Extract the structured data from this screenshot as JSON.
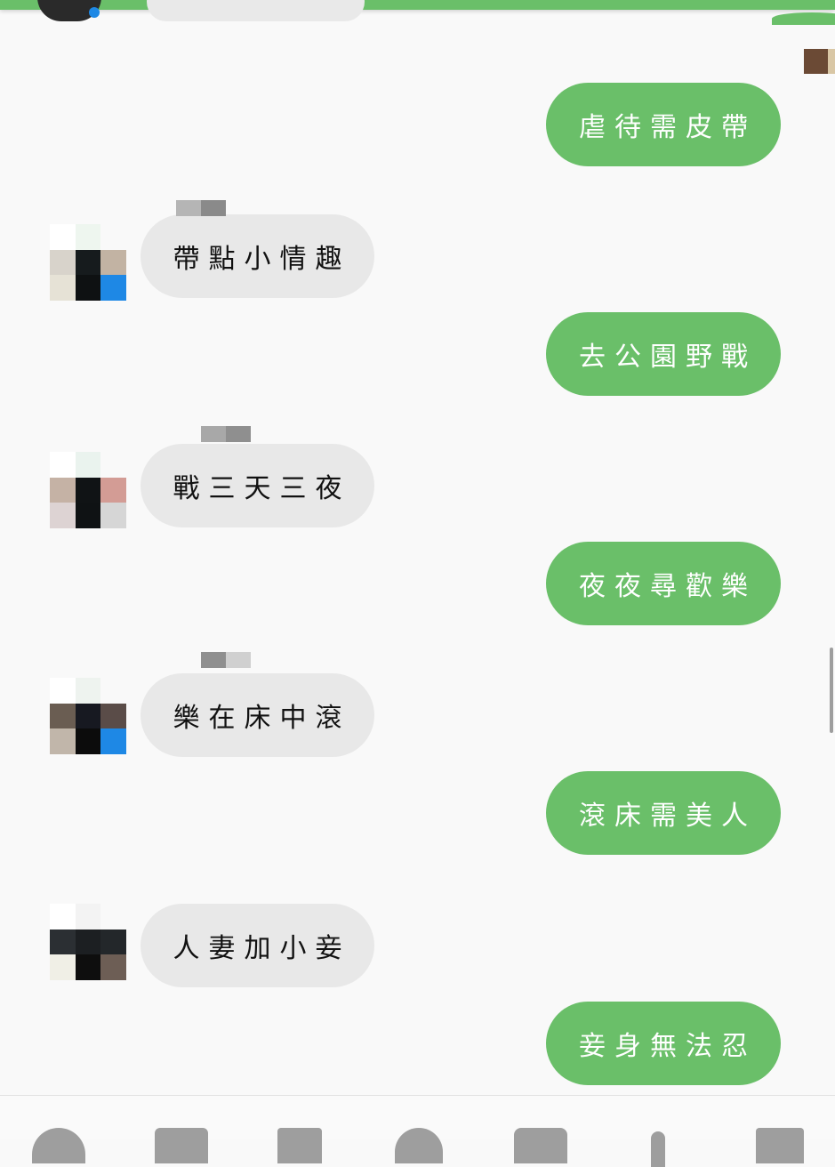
{
  "colors": {
    "accent": "#6abf69",
    "incoming_bubble": "#e8e8e8",
    "background": "#f9f9f9",
    "badge_blue": "#1e88e5"
  },
  "messages": [
    {
      "direction": "out",
      "text": "虐待需皮帶"
    },
    {
      "direction": "in",
      "text": "帶點小情趣"
    },
    {
      "direction": "out",
      "text": "去公園野戰"
    },
    {
      "direction": "in",
      "text": "戰三天三夜"
    },
    {
      "direction": "out",
      "text": "夜夜尋歡樂"
    },
    {
      "direction": "in",
      "text": "樂在床中滾"
    },
    {
      "direction": "out",
      "text": "滾床需美人"
    },
    {
      "direction": "in",
      "text": "人妻加小妾"
    },
    {
      "direction": "out",
      "text": "妾身無法忍"
    }
  ],
  "bottom_nav": [
    {
      "icon": "messenger-icon"
    },
    {
      "icon": "camera-icon"
    },
    {
      "icon": "image-icon"
    },
    {
      "icon": "sticker-icon"
    },
    {
      "icon": "gif-icon"
    },
    {
      "icon": "microphone-icon"
    },
    {
      "icon": "like-icon"
    }
  ]
}
